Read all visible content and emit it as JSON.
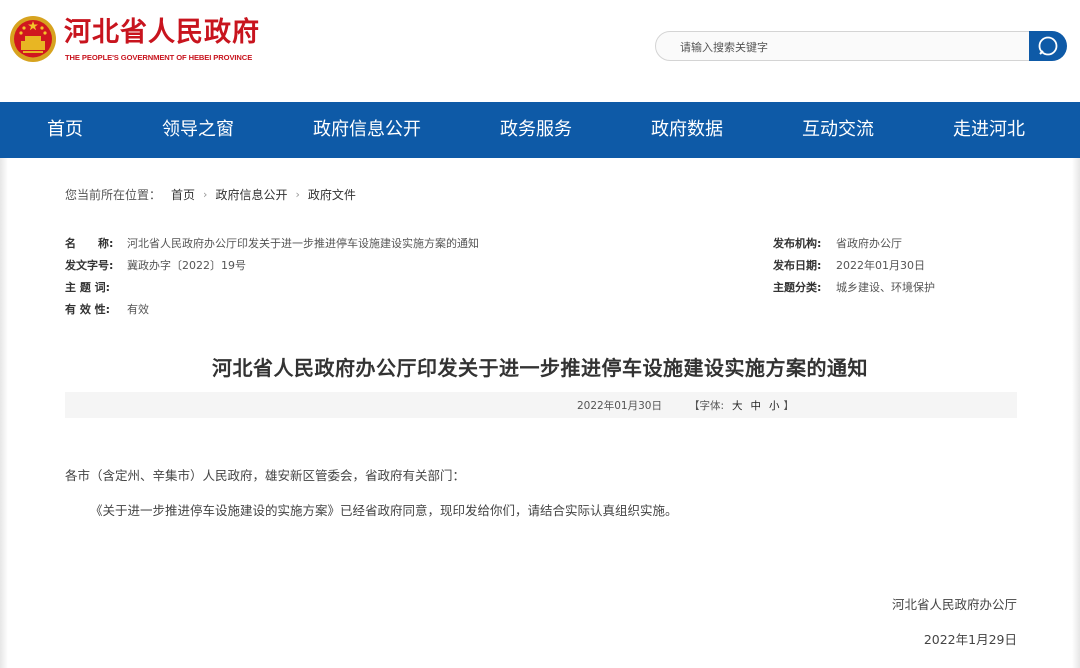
{
  "header": {
    "site_title_cn": "河北省人民政府",
    "site_title_en": "THE PEOPLE'S GOVERNMENT OF HEBEI PROVINCE",
    "search_placeholder": "请输入搜索关键字",
    "search_icon": "search-icon",
    "emblem_icon": "national-emblem-icon"
  },
  "nav": {
    "items": [
      "首页",
      "领导之窗",
      "政府信息公开",
      "政务服务",
      "政府数据",
      "互动交流",
      "走进河北"
    ]
  },
  "breadcrumb": {
    "prefix": "您当前所在位置：",
    "items": [
      "首页",
      "政府信息公开",
      "政府文件"
    ],
    "separator": "›"
  },
  "meta": {
    "name_label": "名　　称:",
    "name_value": "河北省人民政府办公厅印发关于进一步推进停车设施建设实施方案的通知",
    "doc_no_label": "发文字号:",
    "doc_no_value": "冀政办字〔2022〕19号",
    "subject_label": "主 题 词:",
    "subject_value": "",
    "validity_label": "有 效 性:",
    "validity_value": "有效",
    "issuer_label": "发布机构:",
    "issuer_value": "省政府办公厅",
    "pub_date_label": "发布日期:",
    "pub_date_value": "2022年01月30日",
    "category_label": "主题分类:",
    "category_value": "城乡建设、环境保护"
  },
  "document": {
    "title": "河北省人民政府办公厅印发关于进一步推进停车设施建设实施方案的通知",
    "date": "2022年01月30日",
    "font_size_prefix": "【字体:",
    "font_size_options": [
      "大",
      "中",
      "小"
    ],
    "font_size_suffix": "】",
    "salutation": "各市（含定州、辛集市）人民政府，雄安新区管委会，省政府有关部门：",
    "body": "《关于进一步推进停车设施建设的实施方案》已经省政府同意，现印发给你们，请结合实际认真组织实施。",
    "signature": "河北省人民政府办公厅",
    "sign_date": "2022年1月29日"
  },
  "colors": {
    "brand_red": "#c8141e",
    "nav_blue": "#0e5aa7"
  }
}
